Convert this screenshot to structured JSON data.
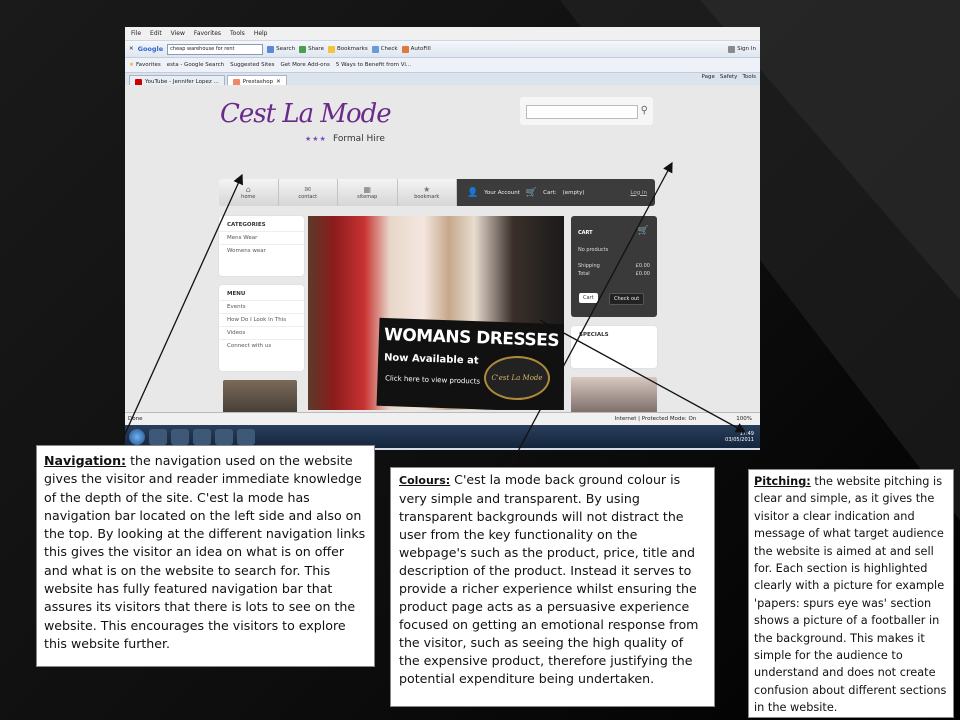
{
  "browser": {
    "menu": [
      "File",
      "Edit",
      "View",
      "Favorites",
      "Tools",
      "Help"
    ],
    "google_query": "cheap warehouse for rent",
    "toolbar": [
      "Search",
      "Share",
      "Bookmarks",
      "Check",
      "AutoFill",
      "Sign In"
    ],
    "favorites_label": "Favorites",
    "favorites": [
      "esta - Google Search",
      "Suggested Sites",
      "Get More Add-ons",
      "5 Ways to Benefit from Vi..."
    ],
    "tabs": [
      "YouTube - Jennifer Lopez ...",
      "Prestashop"
    ],
    "command_bar": [
      "Page",
      "Safety",
      "Tools"
    ],
    "status_left": "Done",
    "status_zone": "Internet | Protected Mode: On",
    "zoom": "100%",
    "clock_time": "17:49",
    "clock_date": "03/05/2011"
  },
  "site": {
    "logo": "Cest La Mode",
    "tagline_stars": "★★★",
    "tagline": "Formal Hire",
    "nav": [
      {
        "label": "home",
        "icon": "home-icon"
      },
      {
        "label": "contact",
        "icon": "mail-icon"
      },
      {
        "label": "sitemap",
        "icon": "sitemap-icon"
      },
      {
        "label": "bookmark",
        "icon": "star-icon"
      }
    ],
    "account": {
      "your_account": "Your Account",
      "cart": "Cart:",
      "cart_status": "(empty)",
      "login": "Log in"
    },
    "categories": {
      "title": "CATEGORIES",
      "items": [
        "Mens Wear",
        "Womens wear"
      ]
    },
    "menu": {
      "title": "MENU",
      "items": [
        "Events",
        "How Do I Look in This",
        "Videos",
        "Connect with us"
      ]
    },
    "banner": {
      "headline": "WOMANS DRESSES",
      "subline": "Now Available at",
      "cta": "Click here to view products",
      "seal": "C'est La Mode"
    },
    "cart_block": {
      "title": "CART",
      "no_products": "No products",
      "shipping_label": "Shipping",
      "shipping": "£0.00",
      "total_label": "Total",
      "total": "£0.00",
      "cart_button": "Cart",
      "checkout_button": "Check out"
    },
    "specials_title": "SPECIALS"
  },
  "notes": {
    "navigation": {
      "heading": "Navigation:",
      "body": " the navigation used on the website gives the visitor and reader immediate knowledge of the depth of the site. C'est la mode has navigation bar located on the left side and also on the top.  By looking at the different navigation links this gives the visitor an idea on what is on offer and what is on the website to search for. This website has fully featured navigation bar that assures its visitors that there is lots to see on the website.  This encourages the visitors to explore this website further."
    },
    "colours": {
      "heading": "Colours:",
      "body": " C'est la mode back ground colour is very simple and transparent. By using transparent backgrounds will not distract the user from the key functionality on the webpage's such as the product, price, title and description of the product. Instead it serves to provide a richer experience whilst ensuring the product page acts as a persuasive experience focused on getting an emotional response from the visitor, such as seeing the high quality of the expensive product, therefore justifying the potential expenditure being undertaken."
    },
    "pitching": {
      "heading": "Pitching:",
      "body": " the website pitching is clear and simple, as it gives the visitor a clear indication and message of what target audience the website is aimed at and sell for. Each section is highlighted clearly with a picture for example 'papers: spurs eye was' section shows a picture of a footballer in the background. This makes it simple for the audience to understand and does not create confusion about different sections in the website."
    }
  }
}
